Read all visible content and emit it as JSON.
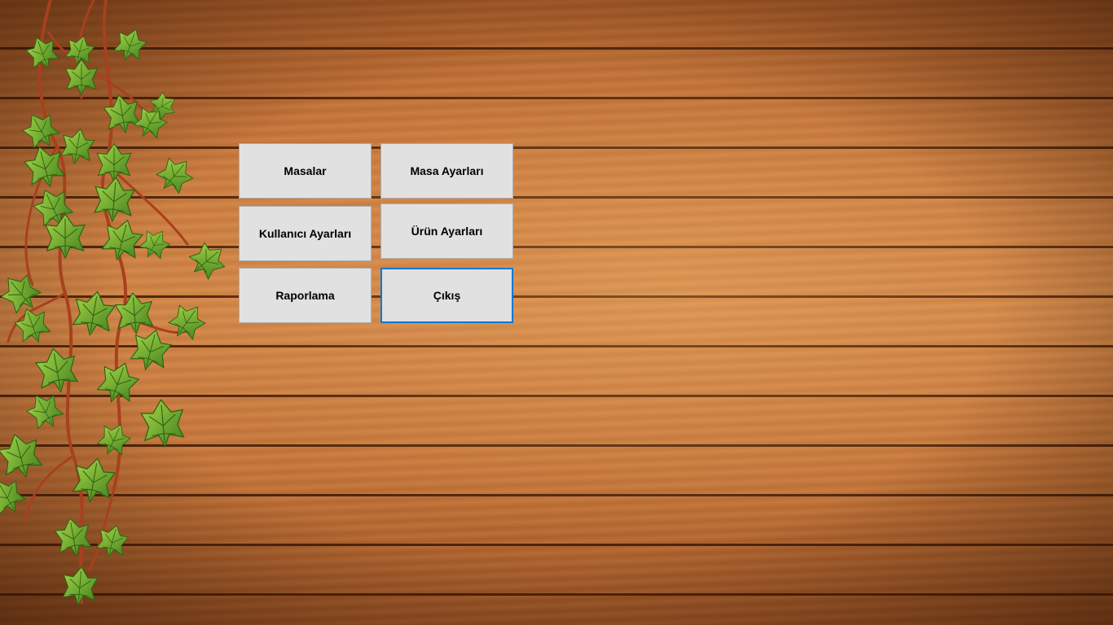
{
  "menu": {
    "masalar": "Masalar",
    "masa_ayarlari": "Masa Ayarları",
    "kullanici_ayarlari": "Kullanıcı Ayarları",
    "urun_ayarlari": "Ürün Ayarları",
    "raporlama": "Raporlama",
    "cikis": "Çıkış"
  },
  "colors": {
    "button_bg": "#e1e1e1",
    "button_border": "#adadad",
    "focus_border": "#0078d7",
    "wood": "#cf7d3e",
    "leaf": "#6fae2e",
    "vine_stem": "#a8401e"
  },
  "background": {
    "texture": "wood-planks",
    "decoration": "ivy-vine-icon"
  }
}
